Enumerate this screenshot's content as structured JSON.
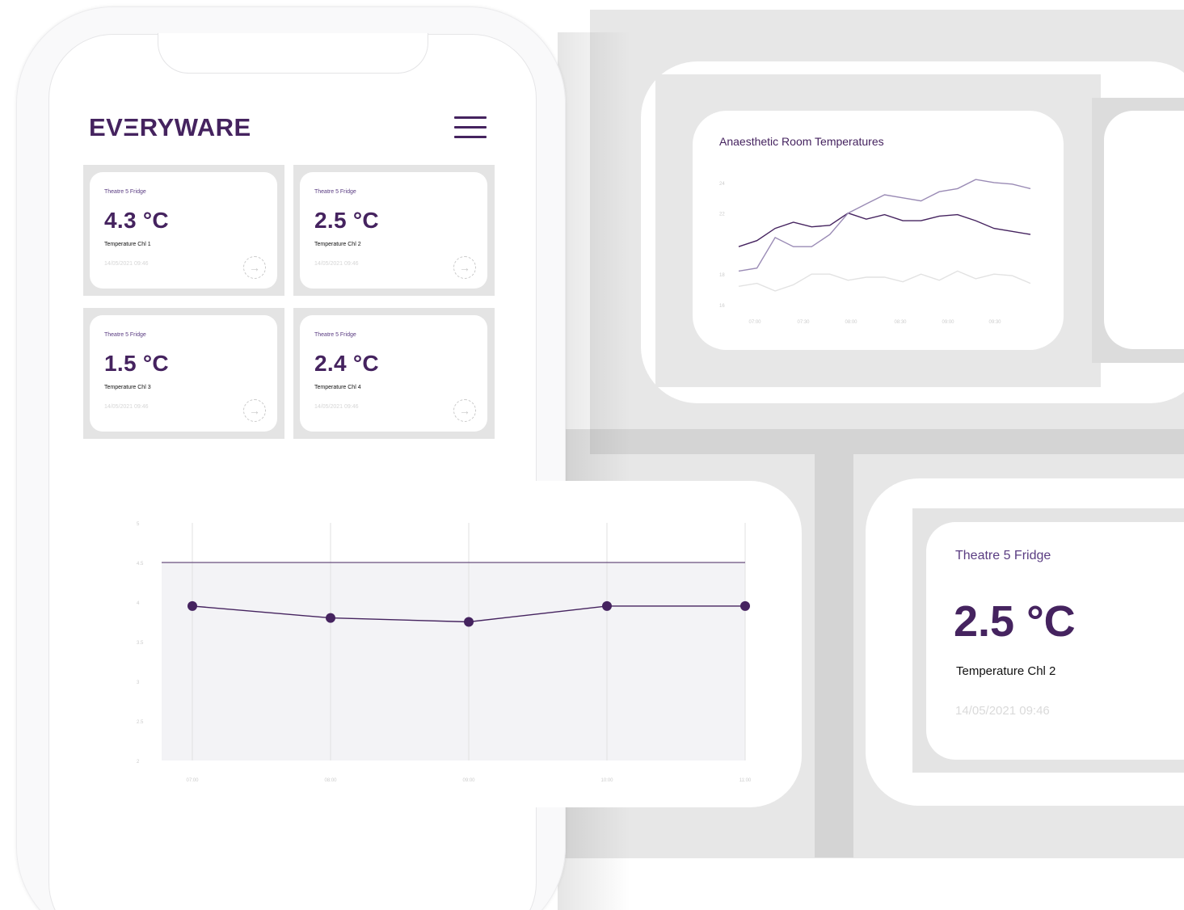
{
  "colors": {
    "brand_purple": "#45235f",
    "light_purple": "#9a8bb5",
    "very_light": "#e2e2e2",
    "panel_grey": "#e7e7e7"
  },
  "phone": {
    "logo": "EVΞRYWARE",
    "menu_icon": "hamburger-icon",
    "cards": [
      {
        "title": "Theatre 5 Fridge",
        "value": "4.3 °C",
        "label": "Temperature Chl 1",
        "date": "14/05/2021 09:46"
      },
      {
        "title": "Theatre 5 Fridge",
        "value": "2.5 °C",
        "label": "Temperature Chl 2",
        "date": "14/05/2021 09:46"
      },
      {
        "title": "Theatre 5 Fridge",
        "value": "1.5 °C",
        "label": "Temperature Chl 3",
        "date": "14/05/2021 09:46"
      },
      {
        "title": "Theatre 5 Fridge",
        "value": "2.4 °C",
        "label": "Temperature Chl 4",
        "date": "14/05/2021 09:46"
      }
    ]
  },
  "detail_card": {
    "title": "Theatre 5 Fridge",
    "value": "2.5 °C",
    "label": "Temperature Chl 2",
    "date": "14/05/2021 09:46"
  },
  "chart_data": [
    {
      "type": "line",
      "title": "Anaesthetic Room Temperatures",
      "x_ticks": [
        "07:00",
        "07:30",
        "08:00",
        "08:30",
        "09:00",
        "09:30"
      ],
      "y_ticks": [
        16,
        18,
        22,
        24
      ],
      "ylim": [
        16,
        25
      ],
      "grid": false,
      "series": [
        {
          "color": "#45235f",
          "x": [
            0,
            1,
            2,
            3,
            4,
            5,
            6,
            7,
            8,
            9,
            10,
            11,
            12,
            13,
            14,
            15,
            16
          ],
          "values": [
            19.8,
            20.2,
            21.0,
            21.4,
            21.1,
            21.2,
            22.0,
            21.6,
            21.9,
            21.5,
            21.5,
            21.8,
            21.9,
            21.5,
            21.0,
            20.8,
            20.6
          ]
        },
        {
          "color": "#9a8bb5",
          "x": [
            0,
            1,
            2,
            3,
            4,
            5,
            6,
            7,
            8,
            9,
            10,
            11,
            12,
            13,
            14,
            15,
            16
          ],
          "values": [
            18.2,
            18.4,
            20.4,
            19.8,
            19.8,
            20.6,
            22.0,
            22.6,
            23.2,
            23.0,
            22.8,
            23.4,
            23.6,
            24.2,
            24.0,
            23.9,
            23.6
          ]
        },
        {
          "color": "#e2e2e2",
          "x": [
            0,
            1,
            2,
            3,
            4,
            5,
            6,
            7,
            8,
            9,
            10,
            11,
            12,
            13,
            14,
            15,
            16
          ],
          "values": [
            17.2,
            17.4,
            16.9,
            17.3,
            18.0,
            18.0,
            17.6,
            17.8,
            17.8,
            17.5,
            18.0,
            17.6,
            18.2,
            17.7,
            18.0,
            17.9,
            17.4
          ]
        }
      ]
    },
    {
      "type": "line",
      "x_ticks": [
        "07:00",
        "08:00",
        "09:00",
        "10:00",
        "11:00"
      ],
      "y_ticks": [
        2,
        2.5,
        3,
        3.5,
        4,
        4.5,
        5
      ],
      "ylim": [
        2,
        5
      ],
      "grid": true,
      "threshold": 4.5,
      "series": [
        {
          "color": "#45235f",
          "values": [
            3.95,
            3.8,
            3.75,
            3.95,
            3.95
          ]
        }
      ]
    }
  ]
}
